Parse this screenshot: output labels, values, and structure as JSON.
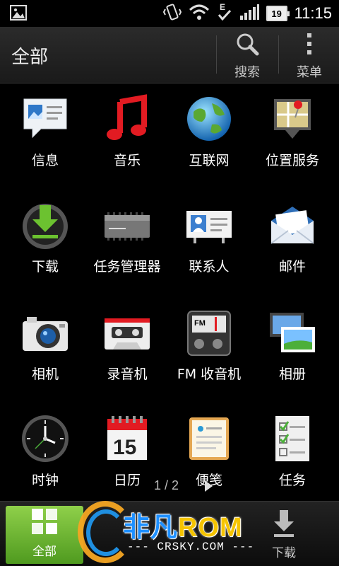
{
  "status_bar": {
    "time": "11:15",
    "battery": "19",
    "icons": [
      "image-icon",
      "vibrate-icon",
      "wifi-icon",
      "data-e-icon",
      "signal-icon"
    ]
  },
  "action_bar": {
    "title": "全部",
    "search_label": "搜索",
    "menu_label": "菜单"
  },
  "apps": [
    {
      "label": "信息",
      "icon": "messages-icon"
    },
    {
      "label": "音乐",
      "icon": "music-icon"
    },
    {
      "label": "互联网",
      "icon": "internet-globe-icon"
    },
    {
      "label": "位置服务",
      "icon": "location-map-icon"
    },
    {
      "label": "下载",
      "icon": "download-icon"
    },
    {
      "label": "任务管理器",
      "icon": "task-manager-chip-icon"
    },
    {
      "label": "联系人",
      "icon": "contacts-card-icon"
    },
    {
      "label": "邮件",
      "icon": "mail-envelope-icon"
    },
    {
      "label": "相机",
      "icon": "camera-icon"
    },
    {
      "label": "录音机",
      "icon": "voice-recorder-cassette-icon"
    },
    {
      "label": "FM 收音机",
      "icon": "fm-radio-icon"
    },
    {
      "label": "相册",
      "icon": "gallery-photos-icon"
    },
    {
      "label": "时钟",
      "icon": "clock-icon"
    },
    {
      "label": "日历",
      "icon": "calendar-icon"
    },
    {
      "label": "便笺",
      "icon": "notes-icon"
    },
    {
      "label": "任务",
      "icon": "tasks-checklist-icon"
    }
  ],
  "pager": {
    "text": "1 / 2"
  },
  "calendar_day": "15",
  "bottom_bar": {
    "all_label": "全部",
    "download_label": "下载"
  },
  "watermark": {
    "brand_cn": "非凡",
    "brand_rom": "ROM",
    "site": "--- CRSKY.COM ---"
  },
  "colors": {
    "accent_green": "#6fb834",
    "watermark_blue": "#1e90ff",
    "watermark_yellow": "#f5c400"
  }
}
